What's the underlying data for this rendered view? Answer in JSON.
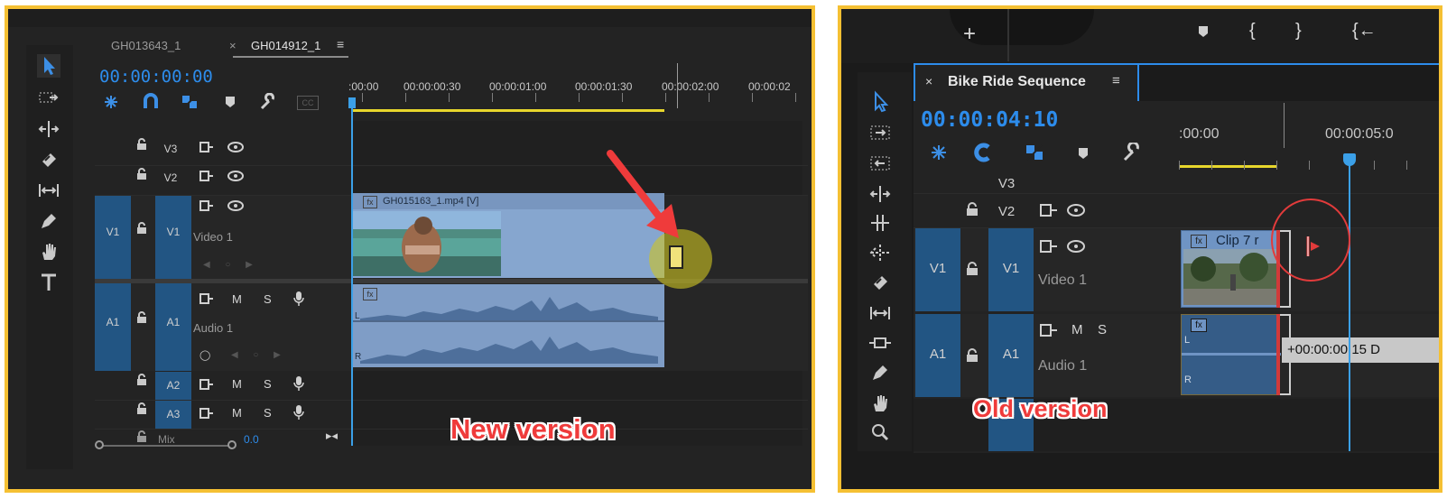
{
  "colors": {
    "frame": "#f5c033",
    "accent_blue": "#2d8ceb",
    "track_blue": "#225583",
    "annotation_red": "#ef3b3b",
    "playhead_blue": "#3ba0e8",
    "clip_blue": "#86a6cf"
  },
  "left": {
    "tabs": [
      "GH013643_1",
      "GH014912_1"
    ],
    "tab_close": "×",
    "tab_menu": "≡",
    "timecode": "00:00:00:00",
    "ruler_labels": [
      ":00:00",
      "00:00:00:30",
      "00:00:01:00",
      "00:00:01:30",
      "00:00:02:00",
      "00:00:02"
    ],
    "tracks": {
      "v3": "V3",
      "v2": "V2",
      "v1_src": "V1",
      "v1": "V1",
      "video_name": "Video 1",
      "a1_src": "A1",
      "a1": "A1",
      "audio_name": "Audio 1",
      "a2": "A2",
      "a3": "A3",
      "mix": "Mix",
      "mix_value": "0.0",
      "m": "M",
      "s": "S"
    },
    "clip_name": "GH015163_1.mp4 [V]",
    "fx": "fx",
    "channel_l": "L",
    "channel_r": "R",
    "annotation": "New version"
  },
  "right": {
    "sequence_close": "×",
    "sequence_name": "Bike Ride Sequence",
    "sequence_menu": "≡",
    "timecode": "00:00:04:10",
    "ruler_labels": [
      ":00:00",
      "00:00:05:0"
    ],
    "tracks": {
      "v3": "V3",
      "v2": "V2",
      "v1_src": "V1",
      "v1": "V1",
      "video_name": "Video 1",
      "a1_src": "A1",
      "a1": "A1",
      "audio_name": "Audio 1",
      "m": "M",
      "s": "S"
    },
    "clip_name": "Clip 7 r",
    "fx": "fx",
    "channel_l": "L",
    "channel_r": "R",
    "tooltip": "+00:00:00:15 D",
    "annotation": "Old version",
    "top_icons": [
      "+",
      "{",
      "}",
      "{←"
    ]
  }
}
